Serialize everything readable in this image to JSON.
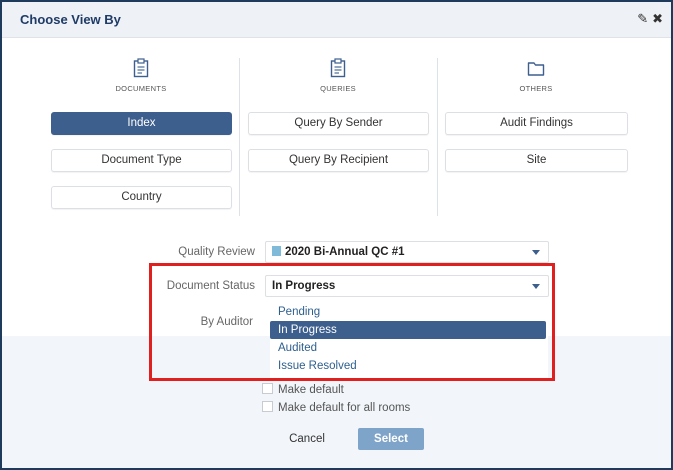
{
  "dialog": {
    "title": "Choose View By",
    "edit_icon": "pencil-icon",
    "close_icon": "close-icon"
  },
  "columns": [
    {
      "label": "DOCUMENTS",
      "icon": "document-clipboard-icon"
    },
    {
      "label": "QUERIES",
      "icon": "query-clipboard-icon"
    },
    {
      "label": "OTHERS",
      "icon": "folder-icon"
    }
  ],
  "view_buttons": {
    "index": "Index",
    "document_type": "Document Type",
    "country": "Country",
    "query_by_sender": "Query By Sender",
    "query_by_recipient": "Query By Recipient",
    "audit_findings": "Audit Findings",
    "site": "Site"
  },
  "fields": {
    "quality_review_label": "Quality Review",
    "quality_review_value": "2020 Bi-Annual QC #1",
    "document_status_label": "Document Status",
    "document_status_value": "In Progress",
    "by_auditor_label": "By Auditor"
  },
  "status_options": [
    "Pending",
    "In Progress",
    "Audited",
    "Issue Resolved"
  ],
  "checkboxes": {
    "make_default": "Make default",
    "make_default_all": "Make default for all rooms"
  },
  "footer": {
    "cancel": "Cancel",
    "select": "Select"
  },
  "colors": {
    "accent": "#3d5f8e",
    "highlight": "#e01f1f",
    "select_button": "#7fa4c9"
  }
}
